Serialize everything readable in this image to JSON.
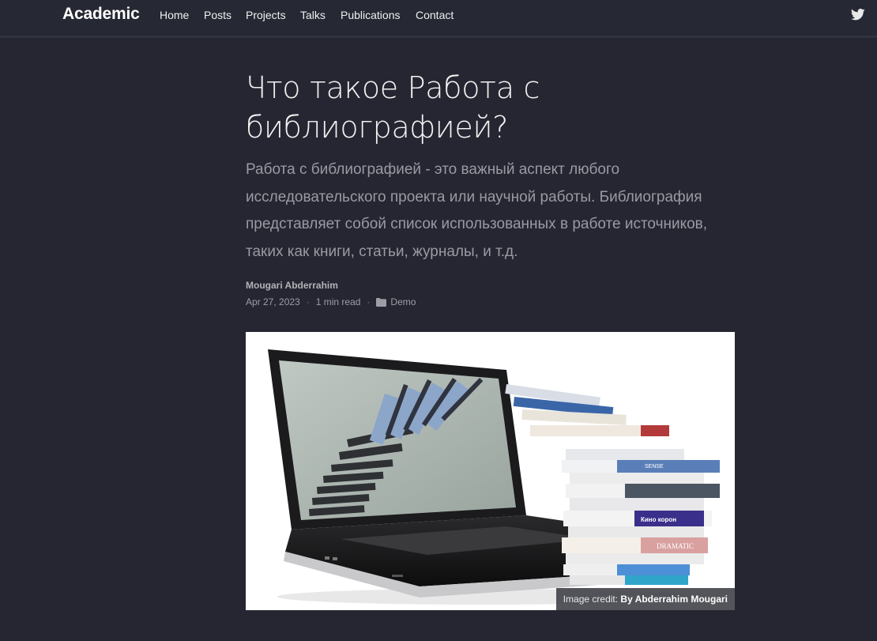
{
  "navbar": {
    "brand": "Academic",
    "items": [
      {
        "label": "Home"
      },
      {
        "label": "Posts"
      },
      {
        "label": "Projects"
      },
      {
        "label": "Talks"
      },
      {
        "label": "Publications"
      },
      {
        "label": "Contact"
      }
    ],
    "social_icon": "twitter-icon"
  },
  "article": {
    "title": "Что такое Работа с библиографией?",
    "summary": "Работа с библиографией - это важный аспект любого исследовательского проекта или научной работы. Библиография представляет собой список использованных в работе источников, таких как книги, статьи, журналы, и т.д.",
    "author": "Mougari Abderrahim",
    "date": "Apr 27, 2023",
    "separator": "·",
    "reading_time": "1 min read",
    "category_icon": "folder-icon",
    "category": "Demo"
  },
  "featured_image": {
    "subject": "laptop-with-books-illustration",
    "credit_prefix": "Image credit:",
    "credit_name": "By Abderrahim Mougari",
    "book_titles": [
      "Кино корон",
      "DRAMATIC",
      "SENSE"
    ]
  },
  "colors": {
    "background": "#252631",
    "navbar": "#262833",
    "text": "#f2f2f2",
    "muted": "#9a9aa3"
  }
}
